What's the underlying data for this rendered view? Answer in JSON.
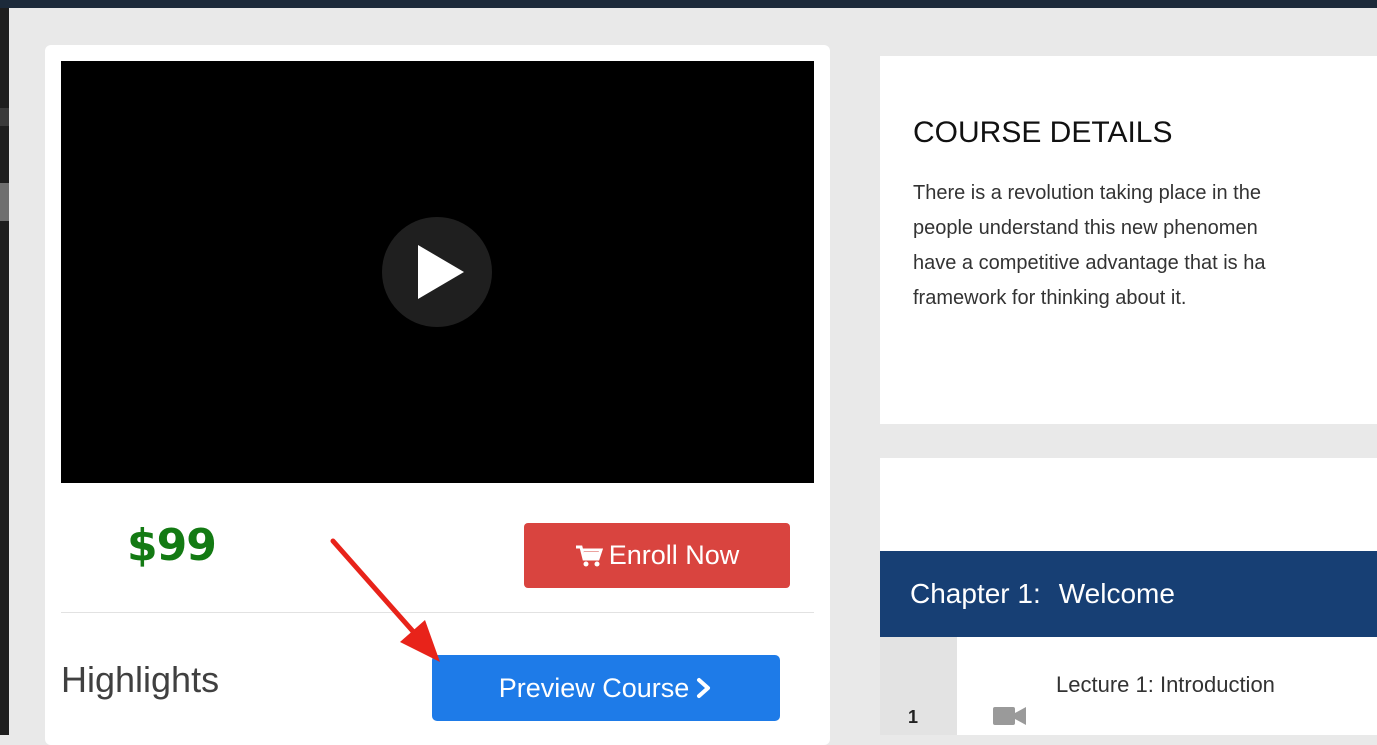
{
  "course": {
    "price": "$99",
    "enroll_label": "Enroll Now",
    "highlights_heading": "Highlights",
    "preview_label": "Preview Course"
  },
  "details": {
    "title": "COURSE DETAILS",
    "lines": [
      "There is a revolution taking place in the",
      "people understand this new phenomen",
      "have a competitive advantage that is ha",
      "framework for thinking about it."
    ]
  },
  "curriculum": {
    "chapter_label": "Chapter 1:",
    "chapter_title": "Welcome",
    "lecture_number": "1",
    "lecture_title": "Lecture 1: Introduction"
  },
  "colors": {
    "price": "#137a13",
    "enroll_button": "#d9443f",
    "preview_button": "#1e7be8",
    "chapter_bar": "#173f74",
    "annotation_arrow": "#e8231a"
  },
  "icons": [
    "play-icon",
    "cart-icon",
    "chevron-right-icon",
    "video-camera-icon",
    "annotation-arrow"
  ]
}
